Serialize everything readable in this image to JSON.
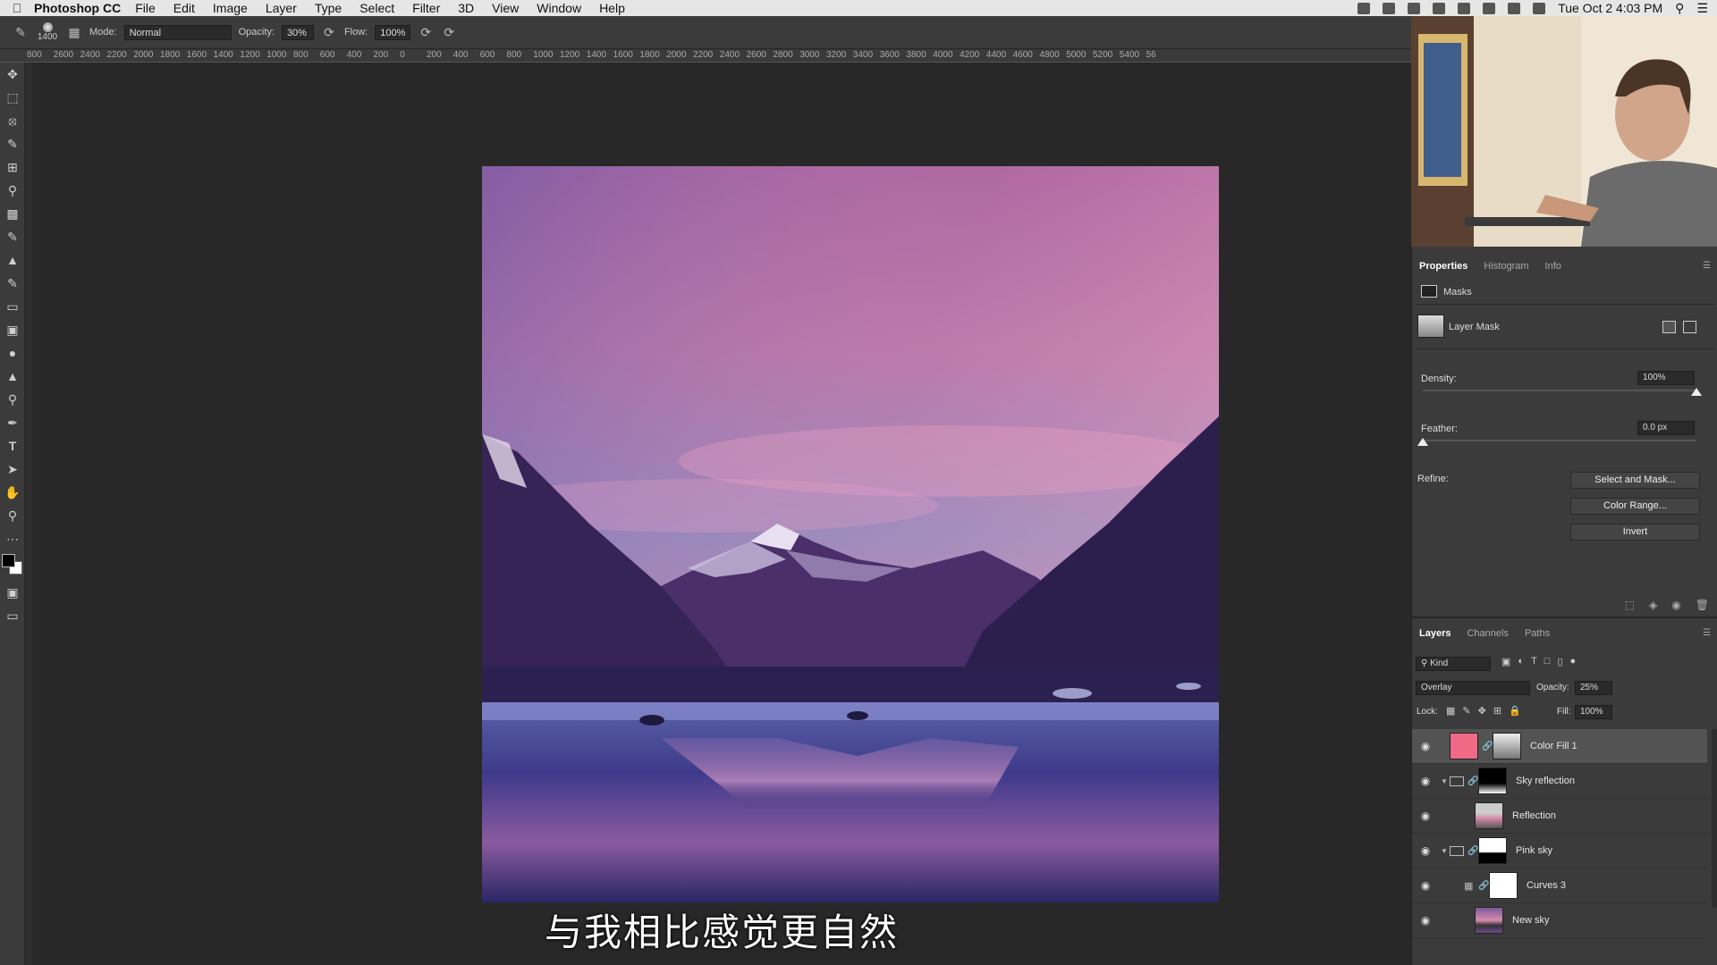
{
  "menubar": {
    "app_name": "Photoshop CC",
    "items": [
      "File",
      "Edit",
      "Image",
      "Layer",
      "Type",
      "Select",
      "Filter",
      "3D",
      "View",
      "Window",
      "Help"
    ],
    "clock": "Tue Oct 2  4:03 PM"
  },
  "options": {
    "brush_size": "1400",
    "mode_label": "Mode:",
    "mode_value": "Normal",
    "opacity_label": "Opacity:",
    "opacity_value": "30%",
    "flow_label": "Flow:",
    "flow_value": "100%"
  },
  "ruler": {
    "ticks": [
      "800",
      "2600",
      "2400",
      "2200",
      "2000",
      "1800",
      "1600",
      "1400",
      "1200",
      "1000",
      "800",
      "600",
      "400",
      "200",
      "0",
      "200",
      "400",
      "600",
      "800",
      "1000",
      "1200",
      "1400",
      "1600",
      "1800",
      "2000",
      "2200",
      "2400",
      "2600",
      "2800",
      "3000",
      "3200",
      "3400",
      "3600",
      "3800",
      "4000",
      "4200",
      "4400",
      "4600",
      "4800",
      "5000",
      "5200",
      "5400",
      "56"
    ]
  },
  "subtitle": "与我相比感觉更自然",
  "properties": {
    "tabs": [
      "Properties",
      "Histogram",
      "Info"
    ],
    "section": "Masks",
    "mask_label": "Layer Mask",
    "density_label": "Density:",
    "density_value": "100%",
    "density_level": 1.0,
    "feather_label": "Feather:",
    "feather_value": "0.0 px",
    "feather_level": 0.0,
    "refine_label": "Refine:",
    "btn_select_mask": "Select and Mask...",
    "btn_color_range": "Color Range...",
    "btn_invert": "Invert"
  },
  "layers_panel": {
    "tabs": [
      "Layers",
      "Channels",
      "Paths"
    ],
    "filter_value": "Kind",
    "blend_mode": "Overlay",
    "opacity_label": "Opacity:",
    "opacity_value": "25%",
    "lock_label": "Lock:",
    "fill_label": "Fill:",
    "fill_value": "100%",
    "layers": [
      {
        "name": "Color Fill 1",
        "selected": true
      },
      {
        "name": "Sky reflection",
        "selected": false
      },
      {
        "name": "Reflection",
        "selected": false
      },
      {
        "name": "Pink sky",
        "selected": false
      },
      {
        "name": "Curves 3",
        "selected": false
      },
      {
        "name": "New sky",
        "selected": false
      }
    ]
  },
  "colors": {
    "accent_fill": "#f06a86",
    "panel_bg": "#3b3b3b"
  }
}
